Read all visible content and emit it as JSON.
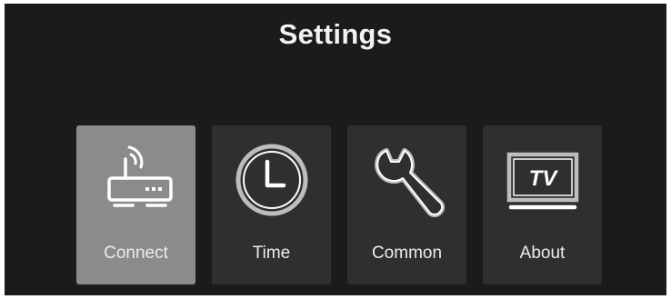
{
  "screen": {
    "title": "Settings",
    "selected_index": 0,
    "colors": {
      "background": "#1b1b1b",
      "tile": "#2f2f2f",
      "tile_selected": "#8b8b8b",
      "text": "#f2f2f2"
    }
  },
  "menu": {
    "items": [
      {
        "label": "Connect",
        "icon": "router-icon"
      },
      {
        "label": "Time",
        "icon": "clock-icon"
      },
      {
        "label": "Common",
        "icon": "wrench-icon"
      },
      {
        "label": "About",
        "icon": "tv-icon"
      }
    ]
  }
}
